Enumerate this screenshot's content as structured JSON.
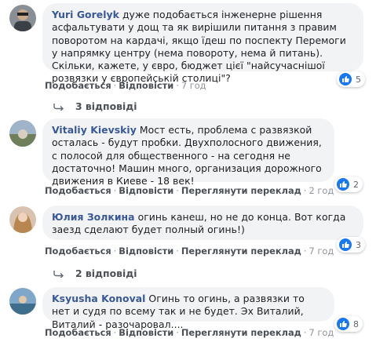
{
  "comments": [
    {
      "author": "Yuri Gorelyk",
      "text": "дуже подобається інженерне рішення асфальтувати у дощ та як вирішили питання з правим поворотом на кардачі, якщо їдеш по поспекту Перемоги у напрямку центру (нема повороту, нема й питань). Скільки, кажете, у євро, бюджет цієї \"найсучаснішої розвязки у європейській столиці\"?",
      "like_label": "Подобається",
      "reply_label": "Відповісти",
      "time": "7 год",
      "reaction_count": "5",
      "replies_label": "3 відповіді"
    },
    {
      "author": "Vitaliy Kievskiy",
      "text": "Мост есть, проблема с развязкой осталась - будут пробки. Двухполосного движения, с полосой для общественного - на сегодня не достаточно! Машин много, организация дорожного движения в Киеве - 18 век!",
      "like_label": "Подобається",
      "reply_label": "Відповісти",
      "translate_label": "Переглянути переклад",
      "time": "2 год",
      "reaction_count": "2"
    },
    {
      "author": "Юлия Золкина",
      "text": "огинь канеш, но не до конца. Вот когда заезд сделают будет полный огинь!)",
      "like_label": "Подобається",
      "reply_label": "Відповісти",
      "translate_label": "Переглянути переклад",
      "time": "7 год",
      "reaction_count": "3",
      "replies_label": "2 відповіді"
    },
    {
      "author": "Ksyusha Konoval",
      "text": "Огинь то огинь, а развязки то нет и судя по всему так и не будет. Эх Виталий, Виталий - разочаровал....",
      "like_label": "Подобається",
      "reply_label": "Відповісти",
      "translate_label": "Переглянути переклад",
      "time": "7 год",
      "reaction_count": "8"
    }
  ],
  "icons": {
    "reaction": "like-icon",
    "replies": "reply-arrow-icon"
  },
  "colors": {
    "author": "#385898",
    "like": "#1877f2",
    "bubble": "#f2f3f5"
  }
}
